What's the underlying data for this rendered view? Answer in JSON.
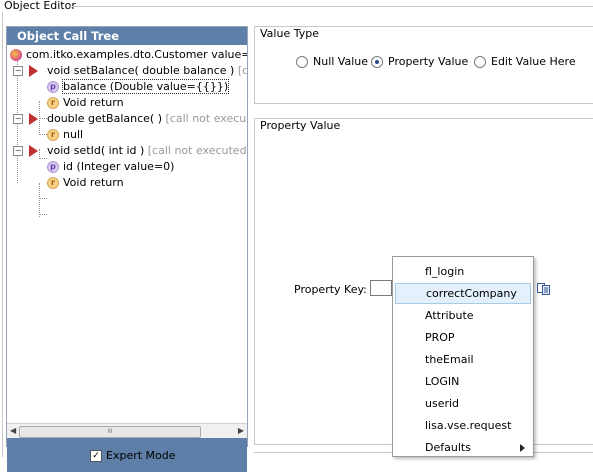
{
  "window": {
    "title": "Object Editor"
  },
  "tree": {
    "header": "Object Call Tree",
    "root": {
      "label": "com.itko.examples.dto.Customer value=null r"
    },
    "nodes": [
      {
        "label": "void setBalance( double balance )",
        "note": "[call not"
      },
      {
        "label": "balance (Double value={{}})"
      },
      {
        "label": "Void return"
      },
      {
        "label": "double getBalance( )",
        "note": "[call not executed..."
      },
      {
        "label": "null"
      },
      {
        "label": "void setId( int id )",
        "note": "[call not executed...]"
      },
      {
        "label": "id (Integer value=0)"
      },
      {
        "label": "Void return"
      }
    ],
    "scroll_grip": "III",
    "expert_mode": {
      "label": "Expert Mode",
      "checked": true
    }
  },
  "value_type": {
    "label": "Value Type",
    "options": [
      "Null Value",
      "Property Value",
      "Edit Value Here"
    ],
    "selected": "Property Value"
  },
  "property_value": {
    "label": "Property Value",
    "key_label": "Property Key:",
    "key_value": ""
  },
  "dropdown": {
    "items": [
      "fl_login",
      "correctCompany",
      "Attribute",
      "PROP",
      "theEmail",
      "LOGIN",
      "userid",
      "lisa.vse.request",
      "Defaults"
    ],
    "highlighted": "correctCompany"
  },
  "colors": {
    "header_bg": "#5d7fa8",
    "selection_bg": "#e4f0fb"
  },
  "icons": [
    "root-object-icon",
    "method-icon",
    "parameter-icon",
    "return-icon",
    "collapse-icon",
    "browse-properties-icon",
    "submenu-arrow-icon",
    "scroll-left-icon",
    "scroll-right-icon",
    "checkbox-checked-icon"
  ]
}
